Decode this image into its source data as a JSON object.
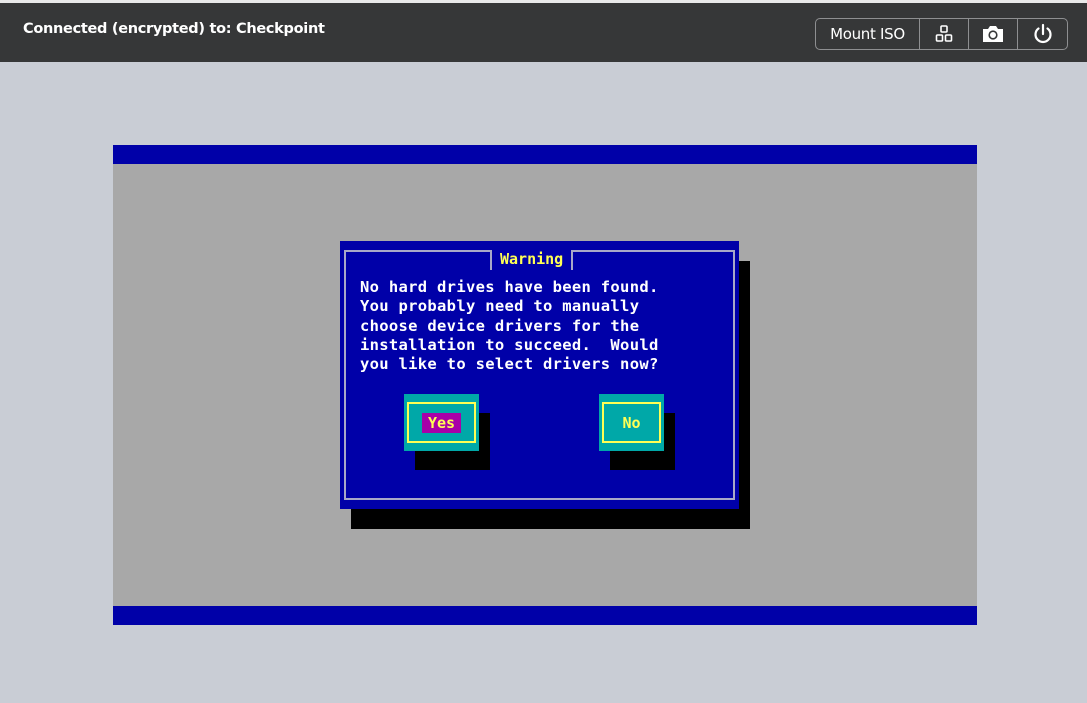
{
  "header": {
    "connection_title": "Connected (encrypted) to: Checkpoint"
  },
  "toolbar": {
    "mount_iso_label": "Mount ISO",
    "icons": [
      "keyboard-keys-icon",
      "camera-icon",
      "power-icon"
    ]
  },
  "console": {
    "dialog": {
      "title": "Warning",
      "message": "No hard drives have been found.\nYou probably need to manually\nchoose device drivers for the\ninstallation to succeed.  Would\nyou like to select drivers now?",
      "yes_label": "Yes",
      "no_label": "No"
    }
  },
  "colors": {
    "topbar": "#363738",
    "page_background": "#c9cdd5",
    "console_blue": "#0000a8",
    "console_gray": "#a8a8a8",
    "button_cyan": "#00a8a8",
    "text_yellow": "#ffff54",
    "selected_magenta": "#a800a8"
  }
}
